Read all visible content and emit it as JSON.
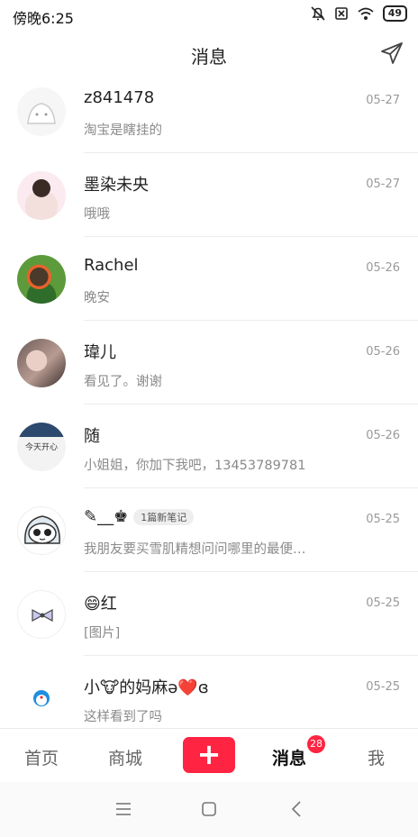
{
  "status_bar": {
    "time": "傍晚6:25",
    "battery": "49"
  },
  "header": {
    "title": "消息"
  },
  "conversations": [
    {
      "name": "z841478",
      "preview": "淘宝是瞎挂的",
      "date": "05-27"
    },
    {
      "name": "墨染未央",
      "preview": "哦哦",
      "date": "05-27"
    },
    {
      "name": "Rachel",
      "preview": "晚安",
      "date": "05-26"
    },
    {
      "name": "瑋儿",
      "preview": "看见了。谢谢",
      "date": "05-26"
    },
    {
      "name": "随",
      "preview": "小姐姐，你加下我吧，13453789781",
      "date": "05-26",
      "avatar_text": "今天开心"
    },
    {
      "name": "✎__♚",
      "tag": "1篇新笔记",
      "preview": "我朋友要买雪肌精想问问哪里的最便…",
      "date": "05-25"
    },
    {
      "name": "😄红",
      "preview": "[图片]",
      "date": "05-25"
    },
    {
      "name": "小🐮的妈麻ə❤️ɞ",
      "preview": "这样看到了吗",
      "date": "05-25"
    }
  ],
  "tab_bar": {
    "home": "首页",
    "mall": "商城",
    "add": "+",
    "messages": "消息",
    "messages_badge": "28",
    "me": "我"
  },
  "colors": {
    "brand": "#ff2442",
    "date": "#9a9a9a",
    "preview": "#8a8a8a"
  }
}
